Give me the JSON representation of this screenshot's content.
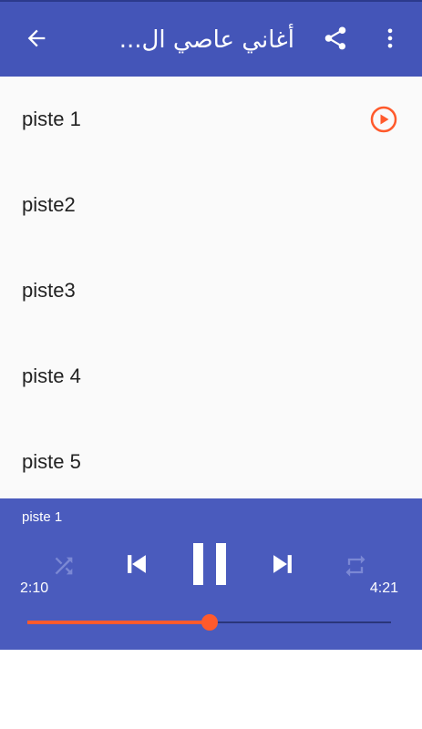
{
  "appbar": {
    "title": "أغاني عاصي ال...",
    "icons": [
      "arrow-back-icon",
      "share-icon",
      "more-vert-icon"
    ]
  },
  "tracks": [
    {
      "label": "piste 1",
      "playing": true
    },
    {
      "label": "piste2",
      "playing": false
    },
    {
      "label": "piste3",
      "playing": false
    },
    {
      "label": "piste 4",
      "playing": false
    },
    {
      "label": "piste 5",
      "playing": false
    }
  ],
  "player": {
    "now_playing": "piste 1",
    "elapsed": "2:10",
    "total": "4:21",
    "progress": 0.5,
    "icons": [
      "shuffle-icon",
      "skip-previous-icon",
      "pause-icon",
      "skip-next-icon",
      "repeat-icon"
    ]
  },
  "colors": {
    "appbar": "#4455b8",
    "player": "#4a5bbd",
    "accent": "#ff5a2c",
    "list_background": "#fafafa"
  }
}
